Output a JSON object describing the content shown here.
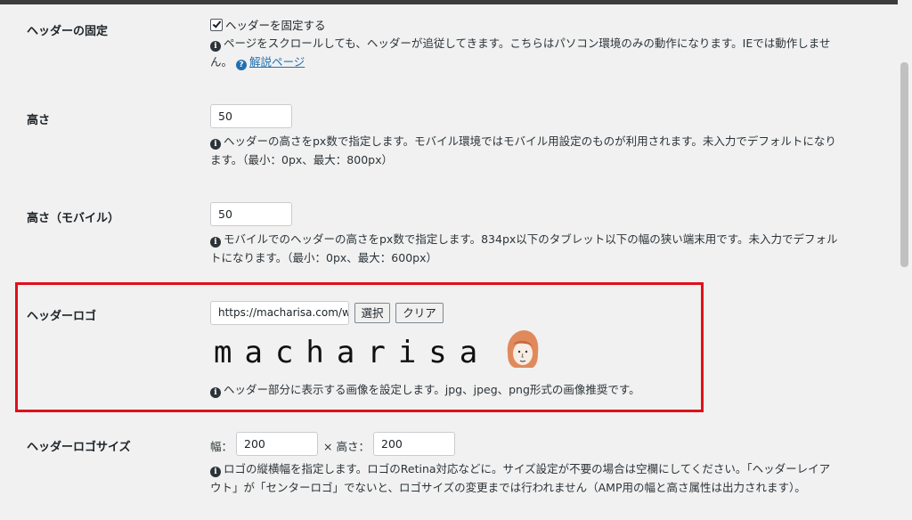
{
  "header_fixed": {
    "label": "ヘッダーの固定",
    "checkbox_label": "ヘッダーを固定する",
    "checked": true,
    "desc_line1": "ページをスクロールしても、ヘッダーが追従してきます。こちらはパソコン環境のみの動作になります。IEでは動作しませ",
    "desc_line2": "ん。",
    "help_link": "解説ページ"
  },
  "height": {
    "label": "高さ",
    "value": "50",
    "desc_line1": "ヘッダーの高さをpx数で指定します。モバイル環境ではモバイル用設定のものが利用されます。未入力でデフォルトになり",
    "desc_line2": "ます。（最小：0px、最大：800px）"
  },
  "height_mobile": {
    "label": "高さ（モバイル）",
    "value": "50",
    "desc_line1": "モバイルでのヘッダーの高さをpx数で指定します。834px以下のタブレット以下の幅の狭い端末用です。未入力でデフォル",
    "desc_line2": "トになります。（最小：0px、最大：600px）"
  },
  "header_logo": {
    "label": "ヘッダーロゴ",
    "url_value": "https://macharisa.com/w",
    "select_button": "選択",
    "clear_button": "クリア",
    "logo_text": "macharisa",
    "desc": "ヘッダー部分に表示する画像を設定します。jpg、jpeg、png形式の画像推奨です。",
    "highlight_color": "#e0101a"
  },
  "logo_size": {
    "label": "ヘッダーロゴサイズ",
    "width_label": "幅：",
    "width_value": "200",
    "height_label": "× 高さ：",
    "height_value": "200",
    "desc_line1": "ロゴの縦横幅を指定します。ロゴのRetina対応などに。サイズ設定が不要の場合は空欄にしてください。「ヘッダーレイア",
    "desc_line2": "ウト」が「センターロゴ」でないと、ロゴサイズの変更までは行われません（AMP用の幅と高さ属性は出力されます）。"
  },
  "icons": {
    "info": "info-circle-icon",
    "help": "question-circle-icon",
    "check": "checkmark-icon"
  }
}
